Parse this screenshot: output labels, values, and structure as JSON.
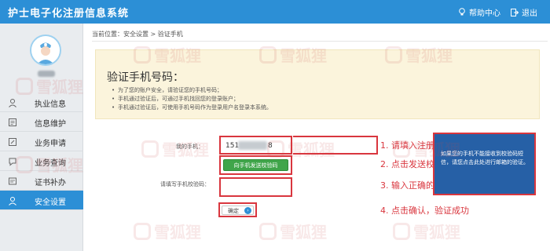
{
  "header": {
    "title": "护士电子化注册信息系统",
    "help_label": "帮助中心",
    "logout_label": "退出"
  },
  "sidebar": {
    "items": [
      {
        "label": "执业信息",
        "icon": "id-card-icon",
        "active": false
      },
      {
        "label": "信息维护",
        "icon": "document-icon",
        "active": false
      },
      {
        "label": "业务申请",
        "icon": "application-icon",
        "active": false
      },
      {
        "label": "业务查询",
        "icon": "query-icon",
        "active": false
      },
      {
        "label": "证书补办",
        "icon": "certificate-icon",
        "active": false
      },
      {
        "label": "安全设置",
        "icon": "security-icon",
        "active": true
      }
    ]
  },
  "breadcrumb": "当前位置：安全设置 > 验证手机",
  "notice": {
    "title": "验证手机号码：",
    "items": [
      "为了您的账户安全，请验证您的手机号码；",
      "手机通过验证后，可通过手机找回您的登录账户；",
      "手机通过验证后，可使用手机号码作为登录用户名登录本系统。"
    ]
  },
  "form": {
    "phone_label": "我的手机：",
    "phone_prefix": "151",
    "phone_suffix": "8",
    "send_code_label": "向手机发送校验码",
    "code_label": "请填写手机校验码：",
    "code_value": "",
    "confirm_label": "确定"
  },
  "steps": {
    "step1": "1. 请填入注册时录入的手机号",
    "step2": "2. 点击发送校验码",
    "step3": "3. 输入正确的校验码",
    "step4": "4. 点击确认，验证成功"
  },
  "info_panel": {
    "text": "如果您的手机不能接收到校验码短信，请您点击此处进行邮箱的验证。"
  },
  "watermark": {
    "text": "雪狐狸"
  },
  "colors": {
    "header_blue": "#2c8fd6",
    "highlight_red": "#d9363e",
    "notice_bg": "#fbf4dc",
    "info_panel_bg": "#2660a6",
    "send_button_green": "#40a54a"
  }
}
